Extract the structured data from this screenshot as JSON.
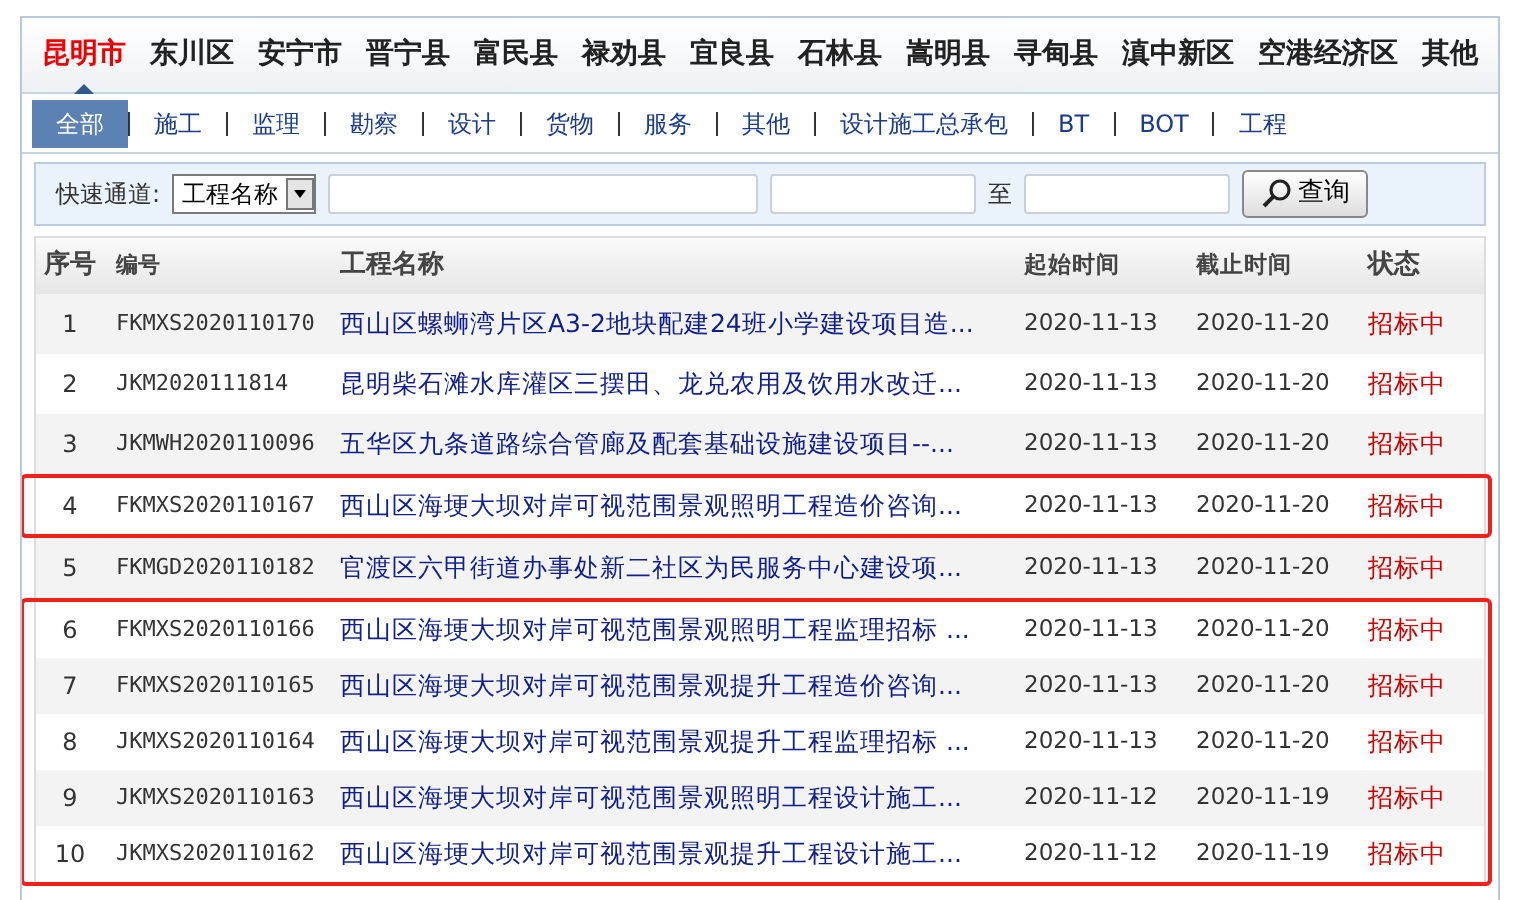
{
  "regions": [
    {
      "label": "昆明市",
      "selected": true
    },
    {
      "label": "东川区",
      "selected": false
    },
    {
      "label": "安宁市",
      "selected": false
    },
    {
      "label": "晋宁县",
      "selected": false
    },
    {
      "label": "富民县",
      "selected": false
    },
    {
      "label": "禄劝县",
      "selected": false
    },
    {
      "label": "宜良县",
      "selected": false
    },
    {
      "label": "石林县",
      "selected": false
    },
    {
      "label": "嵩明县",
      "selected": false
    },
    {
      "label": "寻甸县",
      "selected": false
    },
    {
      "label": "滇中新区",
      "selected": false
    },
    {
      "label": "空港经济区",
      "selected": false
    },
    {
      "label": "其他",
      "selected": false
    }
  ],
  "categories": [
    {
      "label": "全部",
      "selected": true
    },
    {
      "label": "施工",
      "selected": false
    },
    {
      "label": "监理",
      "selected": false
    },
    {
      "label": "勘察",
      "selected": false
    },
    {
      "label": "设计",
      "selected": false
    },
    {
      "label": "货物",
      "selected": false
    },
    {
      "label": "服务",
      "selected": false
    },
    {
      "label": "其他",
      "selected": false
    },
    {
      "label": "设计施工总承包",
      "selected": false
    },
    {
      "label": "BT",
      "selected": false
    },
    {
      "label": "BOT",
      "selected": false
    },
    {
      "label": "工程",
      "selected": false
    }
  ],
  "search": {
    "label": "快速通道:",
    "field_select": "工程名称",
    "range_separator": "至",
    "button": "查询"
  },
  "table": {
    "columns": [
      "序号",
      "编号",
      "工程名称",
      "起始时间",
      "截止时间",
      "状态"
    ],
    "rows": [
      {
        "no": "1",
        "code": "FKMXS2020110170",
        "name": "西山区螺蛳湾片区A3-2地块配建24班小学建设项目造...",
        "start": "2020-11-13",
        "end": "2020-11-20",
        "status": "招标中",
        "highlighted": false
      },
      {
        "no": "2",
        "code": "JKM2020111814",
        "name": "昆明柴石滩水库灌区三摆田、龙兑农用及饮用水改迁...",
        "start": "2020-11-13",
        "end": "2020-11-20",
        "status": "招标中",
        "highlighted": false
      },
      {
        "no": "3",
        "code": "JKMWH2020110096",
        "name": "五华区九条道路综合管廊及配套基础设施建设项目--...",
        "start": "2020-11-13",
        "end": "2020-11-20",
        "status": "招标中",
        "highlighted": false
      },
      {
        "no": "4",
        "code": "FKMXS2020110167",
        "name": "西山区海埂大坝对岸可视范围景观照明工程造价咨询...",
        "start": "2020-11-13",
        "end": "2020-11-20",
        "status": "招标中",
        "highlighted": true
      },
      {
        "no": "5",
        "code": "FKMGD2020110182",
        "name": "官渡区六甲街道办事处新二社区为民服务中心建设项...",
        "start": "2020-11-13",
        "end": "2020-11-20",
        "status": "招标中",
        "highlighted": false
      },
      {
        "no": "6",
        "code": "FKMXS2020110166",
        "name": "西山区海埂大坝对岸可视范围景观照明工程监理招标 ...",
        "start": "2020-11-13",
        "end": "2020-11-20",
        "status": "招标中",
        "highlighted": true
      },
      {
        "no": "7",
        "code": "FKMXS2020110165",
        "name": "西山区海埂大坝对岸可视范围景观提升工程造价咨询...",
        "start": "2020-11-13",
        "end": "2020-11-20",
        "status": "招标中",
        "highlighted": true
      },
      {
        "no": "8",
        "code": "JKMXS2020110164",
        "name": "西山区海埂大坝对岸可视范围景观提升工程监理招标 ...",
        "start": "2020-11-13",
        "end": "2020-11-20",
        "status": "招标中",
        "highlighted": true
      },
      {
        "no": "9",
        "code": "JKMXS2020110163",
        "name": "西山区海埂大坝对岸可视范围景观照明工程设计施工...",
        "start": "2020-11-12",
        "end": "2020-11-19",
        "status": "招标中",
        "highlighted": true
      },
      {
        "no": "10",
        "code": "JKMXS2020110162",
        "name": "西山区海埂大坝对岸可视范围景观提升工程设计施工...",
        "start": "2020-11-12",
        "end": "2020-11-19",
        "status": "招标中",
        "highlighted": true
      }
    ]
  }
}
